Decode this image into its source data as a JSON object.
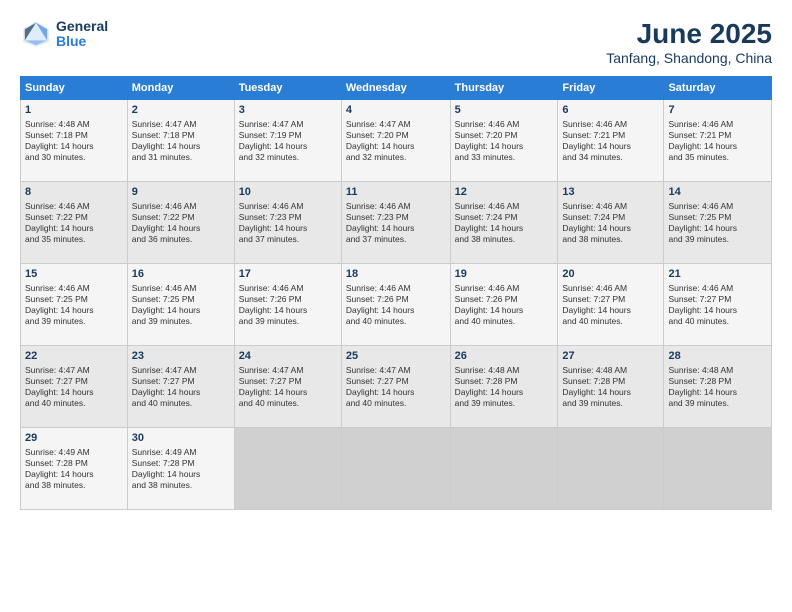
{
  "header": {
    "logo_line1": "General",
    "logo_line2": "Blue",
    "month": "June 2025",
    "location": "Tanfang, Shandong, China"
  },
  "weekdays": [
    "Sunday",
    "Monday",
    "Tuesday",
    "Wednesday",
    "Thursday",
    "Friday",
    "Saturday"
  ],
  "weeks": [
    [
      {
        "day": "1",
        "lines": [
          "Sunrise: 4:48 AM",
          "Sunset: 7:18 PM",
          "Daylight: 14 hours",
          "and 30 minutes."
        ]
      },
      {
        "day": "2",
        "lines": [
          "Sunrise: 4:47 AM",
          "Sunset: 7:18 PM",
          "Daylight: 14 hours",
          "and 31 minutes."
        ]
      },
      {
        "day": "3",
        "lines": [
          "Sunrise: 4:47 AM",
          "Sunset: 7:19 PM",
          "Daylight: 14 hours",
          "and 32 minutes."
        ]
      },
      {
        "day": "4",
        "lines": [
          "Sunrise: 4:47 AM",
          "Sunset: 7:20 PM",
          "Daylight: 14 hours",
          "and 32 minutes."
        ]
      },
      {
        "day": "5",
        "lines": [
          "Sunrise: 4:46 AM",
          "Sunset: 7:20 PM",
          "Daylight: 14 hours",
          "and 33 minutes."
        ]
      },
      {
        "day": "6",
        "lines": [
          "Sunrise: 4:46 AM",
          "Sunset: 7:21 PM",
          "Daylight: 14 hours",
          "and 34 minutes."
        ]
      },
      {
        "day": "7",
        "lines": [
          "Sunrise: 4:46 AM",
          "Sunset: 7:21 PM",
          "Daylight: 14 hours",
          "and 35 minutes."
        ]
      }
    ],
    [
      {
        "day": "8",
        "lines": [
          "Sunrise: 4:46 AM",
          "Sunset: 7:22 PM",
          "Daylight: 14 hours",
          "and 35 minutes."
        ]
      },
      {
        "day": "9",
        "lines": [
          "Sunrise: 4:46 AM",
          "Sunset: 7:22 PM",
          "Daylight: 14 hours",
          "and 36 minutes."
        ]
      },
      {
        "day": "10",
        "lines": [
          "Sunrise: 4:46 AM",
          "Sunset: 7:23 PM",
          "Daylight: 14 hours",
          "and 37 minutes."
        ]
      },
      {
        "day": "11",
        "lines": [
          "Sunrise: 4:46 AM",
          "Sunset: 7:23 PM",
          "Daylight: 14 hours",
          "and 37 minutes."
        ]
      },
      {
        "day": "12",
        "lines": [
          "Sunrise: 4:46 AM",
          "Sunset: 7:24 PM",
          "Daylight: 14 hours",
          "and 38 minutes."
        ]
      },
      {
        "day": "13",
        "lines": [
          "Sunrise: 4:46 AM",
          "Sunset: 7:24 PM",
          "Daylight: 14 hours",
          "and 38 minutes."
        ]
      },
      {
        "day": "14",
        "lines": [
          "Sunrise: 4:46 AM",
          "Sunset: 7:25 PM",
          "Daylight: 14 hours",
          "and 39 minutes."
        ]
      }
    ],
    [
      {
        "day": "15",
        "lines": [
          "Sunrise: 4:46 AM",
          "Sunset: 7:25 PM",
          "Daylight: 14 hours",
          "and 39 minutes."
        ]
      },
      {
        "day": "16",
        "lines": [
          "Sunrise: 4:46 AM",
          "Sunset: 7:25 PM",
          "Daylight: 14 hours",
          "and 39 minutes."
        ]
      },
      {
        "day": "17",
        "lines": [
          "Sunrise: 4:46 AM",
          "Sunset: 7:26 PM",
          "Daylight: 14 hours",
          "and 39 minutes."
        ]
      },
      {
        "day": "18",
        "lines": [
          "Sunrise: 4:46 AM",
          "Sunset: 7:26 PM",
          "Daylight: 14 hours",
          "and 40 minutes."
        ]
      },
      {
        "day": "19",
        "lines": [
          "Sunrise: 4:46 AM",
          "Sunset: 7:26 PM",
          "Daylight: 14 hours",
          "and 40 minutes."
        ]
      },
      {
        "day": "20",
        "lines": [
          "Sunrise: 4:46 AM",
          "Sunset: 7:27 PM",
          "Daylight: 14 hours",
          "and 40 minutes."
        ]
      },
      {
        "day": "21",
        "lines": [
          "Sunrise: 4:46 AM",
          "Sunset: 7:27 PM",
          "Daylight: 14 hours",
          "and 40 minutes."
        ]
      }
    ],
    [
      {
        "day": "22",
        "lines": [
          "Sunrise: 4:47 AM",
          "Sunset: 7:27 PM",
          "Daylight: 14 hours",
          "and 40 minutes."
        ]
      },
      {
        "day": "23",
        "lines": [
          "Sunrise: 4:47 AM",
          "Sunset: 7:27 PM",
          "Daylight: 14 hours",
          "and 40 minutes."
        ]
      },
      {
        "day": "24",
        "lines": [
          "Sunrise: 4:47 AM",
          "Sunset: 7:27 PM",
          "Daylight: 14 hours",
          "and 40 minutes."
        ]
      },
      {
        "day": "25",
        "lines": [
          "Sunrise: 4:47 AM",
          "Sunset: 7:27 PM",
          "Daylight: 14 hours",
          "and 40 minutes."
        ]
      },
      {
        "day": "26",
        "lines": [
          "Sunrise: 4:48 AM",
          "Sunset: 7:28 PM",
          "Daylight: 14 hours",
          "and 39 minutes."
        ]
      },
      {
        "day": "27",
        "lines": [
          "Sunrise: 4:48 AM",
          "Sunset: 7:28 PM",
          "Daylight: 14 hours",
          "and 39 minutes."
        ]
      },
      {
        "day": "28",
        "lines": [
          "Sunrise: 4:48 AM",
          "Sunset: 7:28 PM",
          "Daylight: 14 hours",
          "and 39 minutes."
        ]
      }
    ],
    [
      {
        "day": "29",
        "lines": [
          "Sunrise: 4:49 AM",
          "Sunset: 7:28 PM",
          "Daylight: 14 hours",
          "and 38 minutes."
        ]
      },
      {
        "day": "30",
        "lines": [
          "Sunrise: 4:49 AM",
          "Sunset: 7:28 PM",
          "Daylight: 14 hours",
          "and 38 minutes."
        ]
      },
      {
        "day": "",
        "lines": []
      },
      {
        "day": "",
        "lines": []
      },
      {
        "day": "",
        "lines": []
      },
      {
        "day": "",
        "lines": []
      },
      {
        "day": "",
        "lines": []
      }
    ]
  ]
}
